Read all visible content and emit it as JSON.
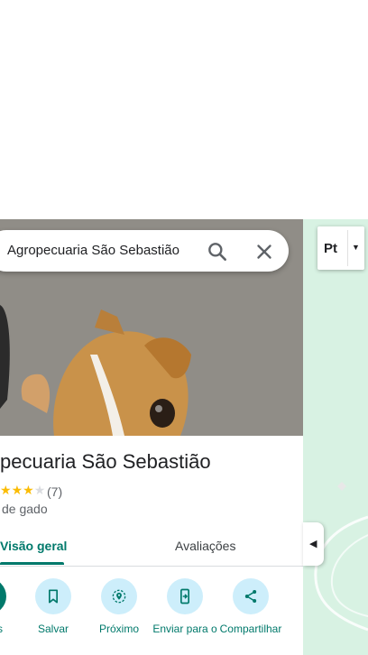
{
  "search": {
    "value": "Agropecuaria São Sebastião",
    "search_icon": "search-icon",
    "clear_icon": "close-icon"
  },
  "place": {
    "title": "pecuaria São Sebastião",
    "rating_stars": 3,
    "review_count": "(7)",
    "category": "de gado"
  },
  "tabs": [
    {
      "label": "Visão geral",
      "active": true
    },
    {
      "label": "Avaliações",
      "active": false
    }
  ],
  "actions": [
    {
      "label": "s",
      "icon": "directions-icon"
    },
    {
      "label": "Salvar",
      "icon": "bookmark-icon"
    },
    {
      "label": "Próximo",
      "icon": "nearby-icon"
    },
    {
      "label": "Enviar para o",
      "icon": "send-to-phone-icon"
    },
    {
      "label": "Compartilhar",
      "icon": "share-icon"
    }
  ],
  "map": {
    "layer_button_label": "Pt",
    "layer_icon": "terrain-layer-icon",
    "collapse_icon": "collapse-panel-icon"
  },
  "colors": {
    "accent": "#00796b",
    "action_circle": "#cdeefb",
    "map_background": "#d8f2e3",
    "star": "#fbbc04"
  }
}
